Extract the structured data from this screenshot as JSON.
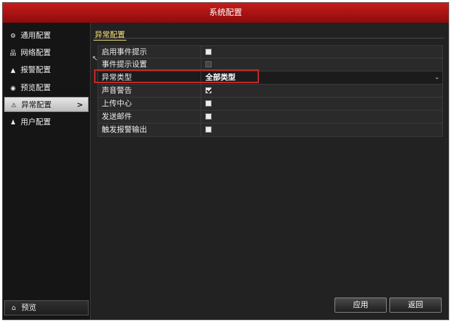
{
  "window": {
    "title": "系统配置"
  },
  "sidebar": {
    "items": [
      {
        "label": "通用配置",
        "icon": "gear-icon",
        "glyph": "⚙"
      },
      {
        "label": "网络配置",
        "icon": "network-icon",
        "glyph": "品"
      },
      {
        "label": "报警配置",
        "icon": "alarm-icon",
        "glyph": "▲"
      },
      {
        "label": "预览配置",
        "icon": "eye-icon",
        "glyph": "◉"
      },
      {
        "label": "异常配置",
        "icon": "warning-icon",
        "glyph": "⚠",
        "chevron": ">"
      },
      {
        "label": "用户配置",
        "icon": "users-icon",
        "glyph": "♟"
      }
    ],
    "bottom": {
      "label": "预览",
      "icon": "home-icon",
      "glyph": "⌂"
    }
  },
  "content": {
    "header": "异常配置",
    "rows": [
      {
        "label": "启用事件提示",
        "type": "checkbox",
        "checked": false
      },
      {
        "label": "事件提示设置",
        "type": "settings"
      },
      {
        "label": "异常类型",
        "type": "dropdown",
        "value": "全部类型",
        "chevron": "⌄"
      },
      {
        "label": "声音警告",
        "type": "checkbox",
        "checked": true
      },
      {
        "label": "上传中心",
        "type": "checkbox",
        "checked": false
      },
      {
        "label": "发送邮件",
        "type": "checkbox",
        "checked": false
      },
      {
        "label": "触发报警输出",
        "type": "checkbox",
        "checked": false
      }
    ],
    "buttons": {
      "apply": "应用",
      "back": "返回"
    },
    "highlight_color": "#c62828"
  },
  "colors": {
    "titlebar": "#b31616",
    "header_accent": "#f7e27a"
  }
}
